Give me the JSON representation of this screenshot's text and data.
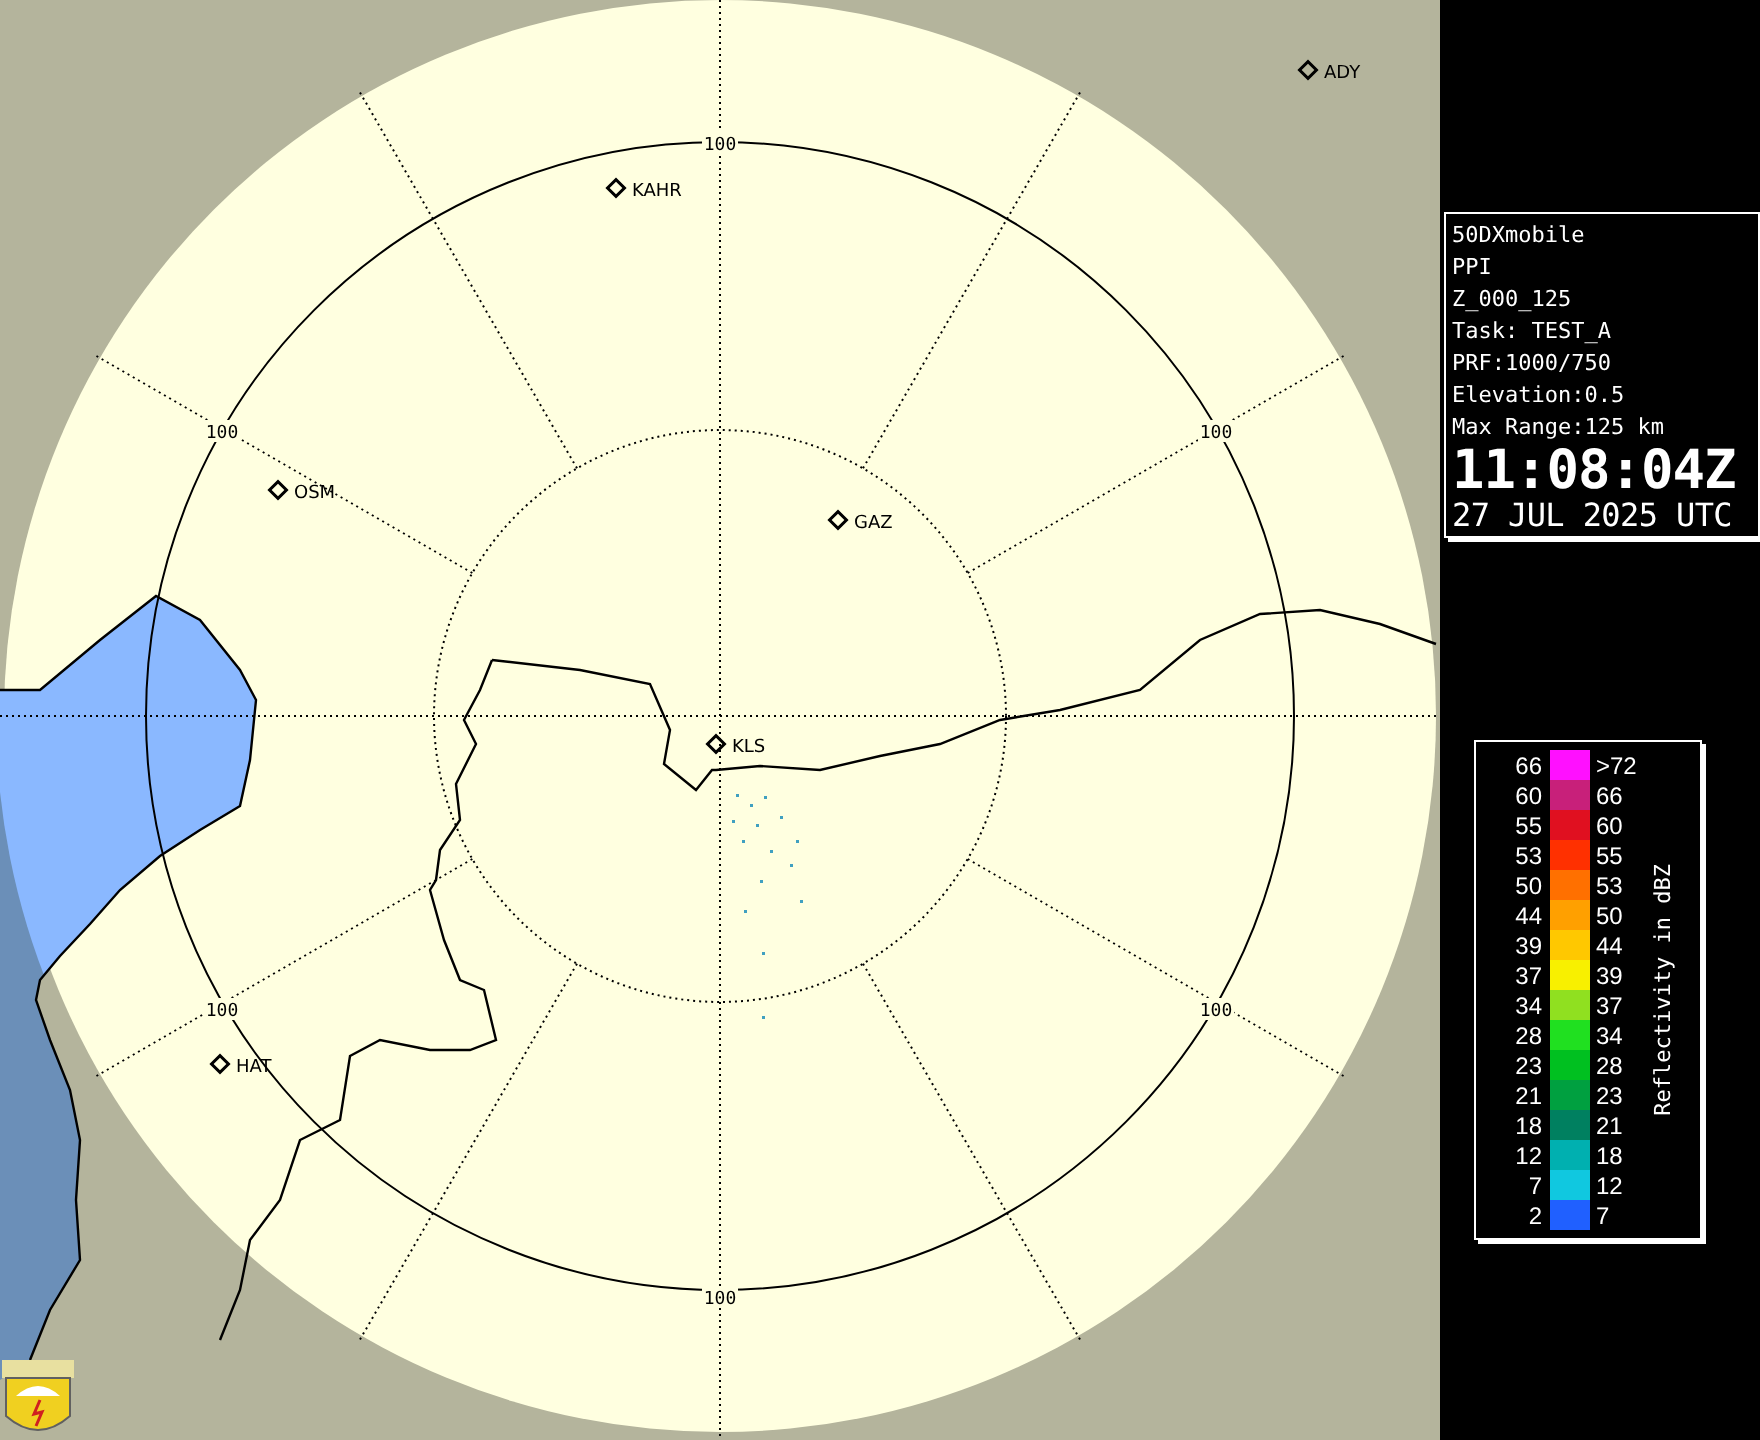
{
  "map": {
    "cities": [
      {
        "name": "ADY"
      },
      {
        "name": "KAHR"
      },
      {
        "name": "OSM"
      },
      {
        "name": "GAZ"
      },
      {
        "name": "KLS"
      },
      {
        "name": "HAT"
      }
    ],
    "range_labels": [
      "100",
      "100",
      "100",
      "100",
      "100",
      "100"
    ]
  },
  "info": {
    "lines": [
      "50DXmobile",
      "PPI",
      "Z_000_125",
      "Task: TEST_A",
      "PRF:1000/750",
      "Elevation:0.5",
      "Max Range:125 km"
    ],
    "time": "11:08:04Z",
    "date": "27 JUL 2025 UTC"
  },
  "legend": {
    "title": "Reflectivity in dBZ",
    "rows": [
      {
        "low": "66",
        "high": ">72",
        "color": "#ff10ff"
      },
      {
        "low": "60",
        "high": "66",
        "color": "#c8207a"
      },
      {
        "low": "55",
        "high": "60",
        "color": "#e01020"
      },
      {
        "low": "53",
        "high": "55",
        "color": "#ff3000"
      },
      {
        "low": "50",
        "high": "53",
        "color": "#ff7000"
      },
      {
        "low": "44",
        "high": "50",
        "color": "#ffa000"
      },
      {
        "low": "39",
        "high": "44",
        "color": "#ffc800"
      },
      {
        "low": "37",
        "high": "39",
        "color": "#f8f000"
      },
      {
        "low": "34",
        "high": "37",
        "color": "#90e020"
      },
      {
        "low": "28",
        "high": "34",
        "color": "#20e020"
      },
      {
        "low": "23",
        "high": "28",
        "color": "#00c020"
      },
      {
        "low": "21",
        "high": "23",
        "color": "#00a040"
      },
      {
        "low": "18",
        "high": "21",
        "color": "#008060"
      },
      {
        "low": "12",
        "high": "18",
        "color": "#00b0b0"
      },
      {
        "low": "7",
        "high": "12",
        "color": "#10c8e0"
      },
      {
        "low": "2",
        "high": "7",
        "color": "#2060ff"
      }
    ]
  }
}
